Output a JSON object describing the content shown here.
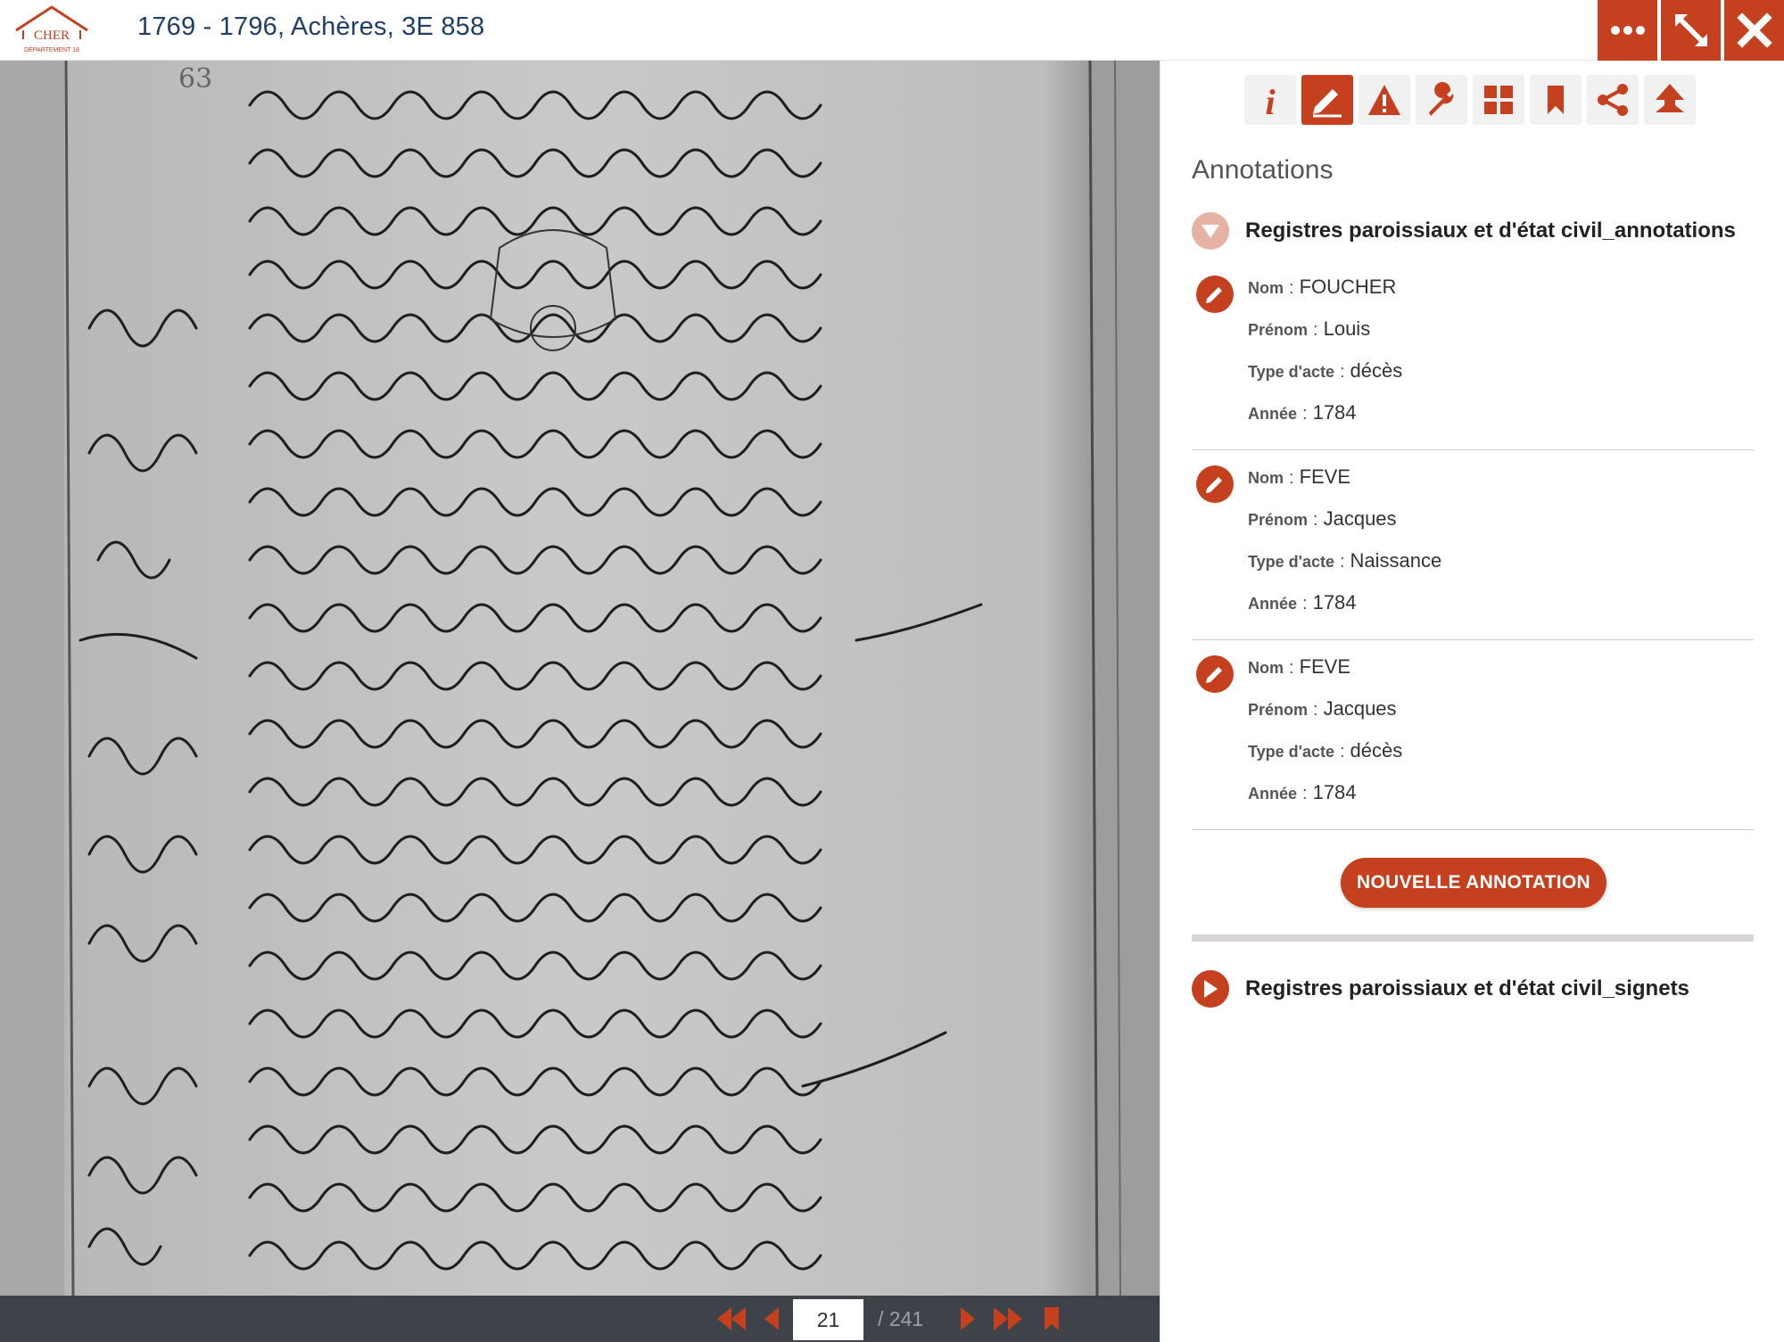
{
  "header": {
    "title": "1769 - 1796, Achères, 3E 858",
    "logo_text": "CHER",
    "logo_subtext": "DÉPARTEMENT 18"
  },
  "header_buttons": [
    "more-icon",
    "expand-icon",
    "close-icon"
  ],
  "viewer": {
    "page_number_label": "63"
  },
  "pager": {
    "current_page": "21",
    "total_pages": "/ 241",
    "icons": [
      "first-page-icon",
      "previous-page-icon",
      "next-page-icon",
      "last-page-icon",
      "bookmark-icon"
    ]
  },
  "panel": {
    "toolbar_icons": [
      "info-icon",
      "annotation-pencil-icon",
      "warning-icon",
      "wrench-icon",
      "grid-icon",
      "bookmark-icon",
      "share-icon",
      "genealogy-icon"
    ],
    "active_tool": "annotation-pencil-icon",
    "title": "Annotations",
    "annotations_section": {
      "label": "Registres paroissiaux et d'état civil_annotations",
      "expanded": true
    },
    "field_labels": {
      "nom": "Nom",
      "prenom": "Prénom",
      "type": "Type d'acte",
      "annee": "Année",
      "separator": ":"
    },
    "entries": [
      {
        "nom": "FOUCHER",
        "prenom": "Louis",
        "type": "décès",
        "annee": "1784"
      },
      {
        "nom": "FEVE",
        "prenom": "Jacques",
        "type": "Naissance",
        "annee": "1784"
      },
      {
        "nom": "FEVE",
        "prenom": "Jacques",
        "type": "décès",
        "annee": "1784"
      }
    ],
    "new_button": "NOUVELLE ANNOTATION",
    "signets_section": {
      "label": "Registres paroissiaux et d'état civil_signets",
      "expanded": false
    }
  },
  "colors": {
    "accent": "#c4401f",
    "title_blue": "#1f3f66",
    "pager_bg": "#3d4349"
  }
}
